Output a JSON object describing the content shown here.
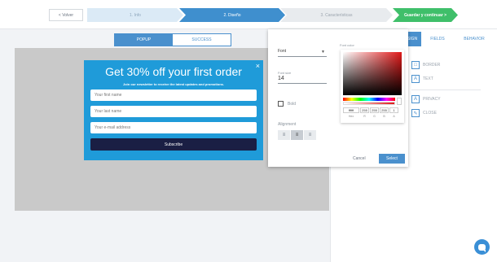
{
  "wizard": {
    "back_label": "< Volver",
    "steps": [
      {
        "label": "1. Info"
      },
      {
        "label": "2. Diseño"
      },
      {
        "label": "3. Características"
      },
      {
        "label": "Guardar y continuar >"
      }
    ]
  },
  "preview_toggle": {
    "popup_label": "POPUP",
    "success_label": "SUCCESS"
  },
  "popup": {
    "title": "Get 30% off your first order",
    "subtitle": "Join our newsletter to receive the latest updates and promotions.",
    "close_glyph": "×",
    "fields": [
      {
        "placeholder": "Your first name"
      },
      {
        "placeholder": "Your last name"
      },
      {
        "placeholder": "Your e-mail address"
      }
    ],
    "submit_label": "Subscribe"
  },
  "panel": {
    "tabs": [
      {
        "label": "SIGN"
      },
      {
        "label": "FIELDS"
      },
      {
        "label": "BEHAVIOR"
      }
    ],
    "options": [
      {
        "label": "BORDER",
        "icon": "square-icon"
      },
      {
        "label": "TEXT",
        "icon": "text-a-icon"
      },
      {
        "label": "PRIVACY",
        "icon": "text-a-icon"
      },
      {
        "label": "CLOSE",
        "icon": "eyedropper-icon"
      }
    ]
  },
  "font_dialog": {
    "font_label": "Font",
    "font_size_label": "Font size",
    "font_size_value": "14",
    "bold_label": "Bold",
    "alignment_label": "Alignment",
    "font_color_label": "Font color",
    "cancel_label": "Cancel",
    "select_label": "Select"
  },
  "color_picker": {
    "hex": "ffffff",
    "r": "255",
    "g": "255",
    "b": "255",
    "a": "1",
    "labels": [
      "Hex",
      "R",
      "G",
      "B",
      "A"
    ]
  },
  "colors": {
    "accent": "#4a90cd",
    "popup_bg": "#1f9bd9",
    "submit_bg": "#1a1f44",
    "save_green": "#3fbf6a"
  }
}
